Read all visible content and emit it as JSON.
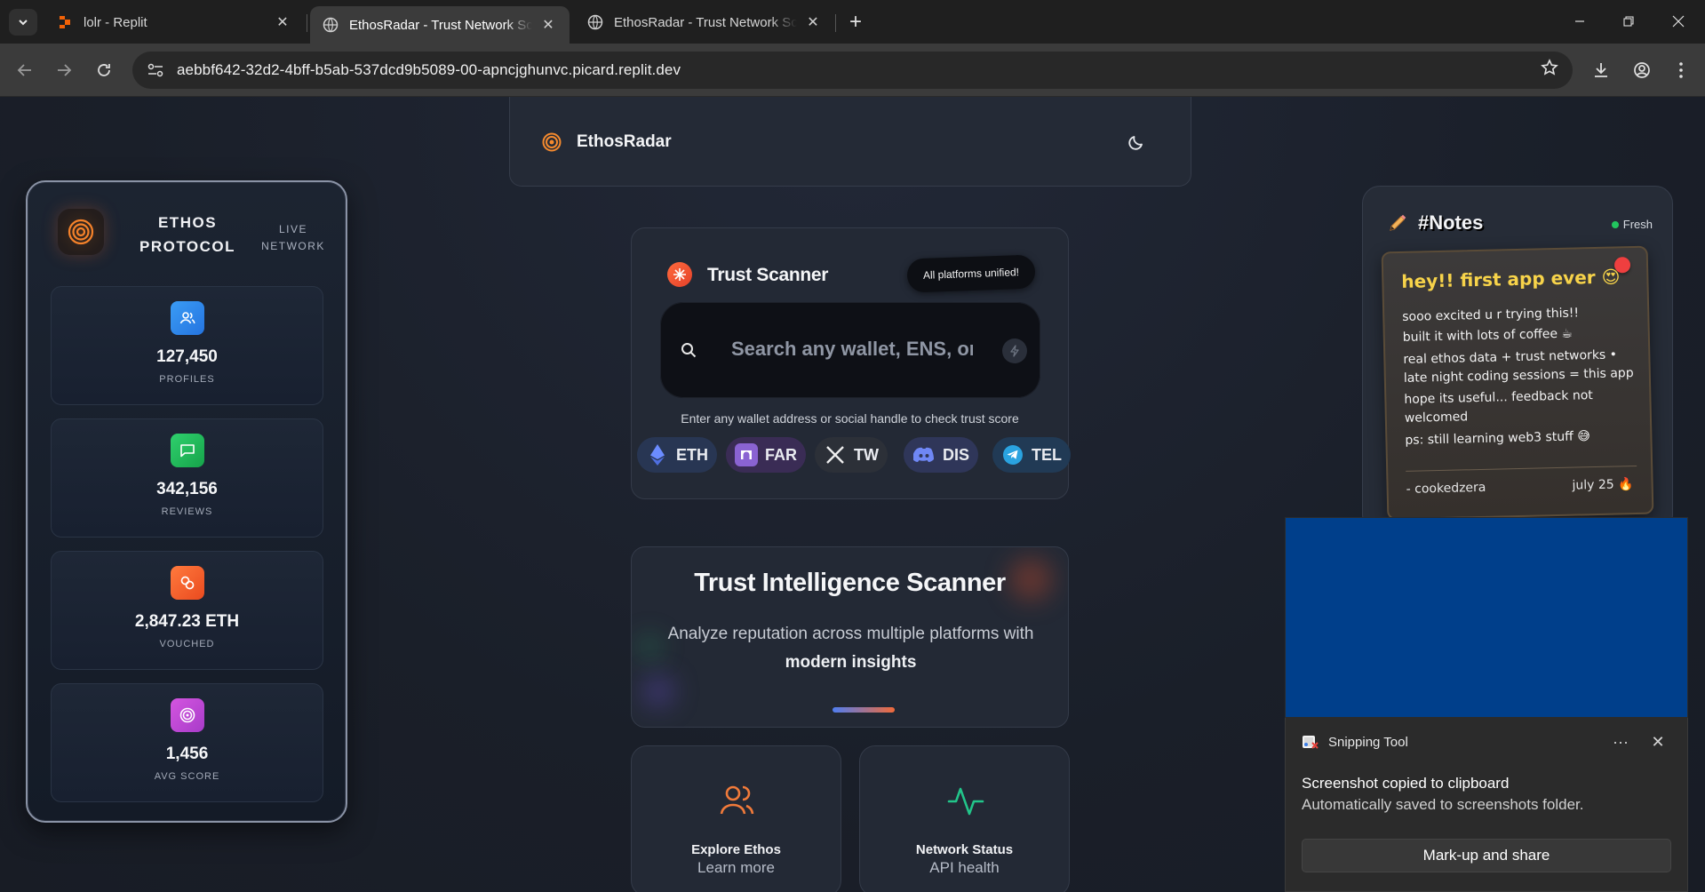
{
  "browser": {
    "tabs": [
      {
        "title": "lolr - Replit",
        "favicon": "replit-icon",
        "active": false
      },
      {
        "title": "EthosRadar - Trust Network Scanner",
        "favicon": "globe-icon",
        "active": true
      },
      {
        "title": "EthosRadar - Trust Network Scanner",
        "favicon": "globe-icon",
        "active": false
      }
    ],
    "url": "aebbf642-32d2-4bff-b5ab-537dcd9b5089-00-apncjghunvc.picard.replit.dev"
  },
  "header": {
    "brand": "EthosRadar",
    "theme_toggle_icon": "moon-icon"
  },
  "stats_panel": {
    "title": "ETHOS PROTOCOL",
    "subtitle": "LIVE NETWORK",
    "cards": [
      {
        "value": "127,450",
        "label": "PROFILES",
        "icon": "users-icon",
        "color": "#2f8ff0"
      },
      {
        "value": "342,156",
        "label": "REVIEWS",
        "icon": "message-icon",
        "color": "#22c55e"
      },
      {
        "value": "2,847.23 ETH",
        "label": "VOUCHED",
        "icon": "link-icon",
        "color": "#f5622e"
      },
      {
        "value": "1,456",
        "label": "AVG SCORE",
        "icon": "target-icon",
        "color": "#c548d8"
      }
    ]
  },
  "scanner": {
    "title": "Trust Scanner",
    "badge": "All platforms unified!",
    "search_placeholder": "Search any wallet, ENS, or social handle",
    "hint": "Enter any wallet address or social handle to check trust score",
    "platforms": [
      {
        "label": "ETH",
        "icon": "ethereum-icon"
      },
      {
        "label": "FAR",
        "icon": "farcaster-icon"
      },
      {
        "label": "TW",
        "icon": "x-icon"
      },
      {
        "label": "DIS",
        "icon": "discord-icon"
      },
      {
        "label": "TEL",
        "icon": "telegram-icon"
      }
    ]
  },
  "intel": {
    "title": "Trust Intelligence Scanner",
    "subtitle_pre": "Analyze reputation across multiple platforms with",
    "subtitle_bold": "modern insights"
  },
  "mini_cards": [
    {
      "title": "Explore Ethos",
      "subtitle": "Learn more",
      "icon": "users-icon"
    },
    {
      "title": "Network Status",
      "subtitle": "API health",
      "icon": "activity-icon"
    }
  ],
  "notes": {
    "title": "#Notes",
    "status": "Fresh",
    "heading": "hey!! first app ever 😍",
    "lines": [
      "sooo excited u r trying this!!",
      "built it with lots of coffee ☕",
      "real ethos data + trust networks •",
      "late night coding sessions = this app",
      "hope its useful... feedback not",
      "welcomed",
      "ps: still learning web3 stuff 😅"
    ],
    "author": "- cookedzera",
    "date": "july 25 🔥"
  },
  "snipping_toast": {
    "app": "Snipping Tool",
    "title": "Screenshot copied to clipboard",
    "body": "Automatically saved to screenshots folder.",
    "button": "Mark-up and share",
    "more": "···",
    "close": "✕"
  }
}
